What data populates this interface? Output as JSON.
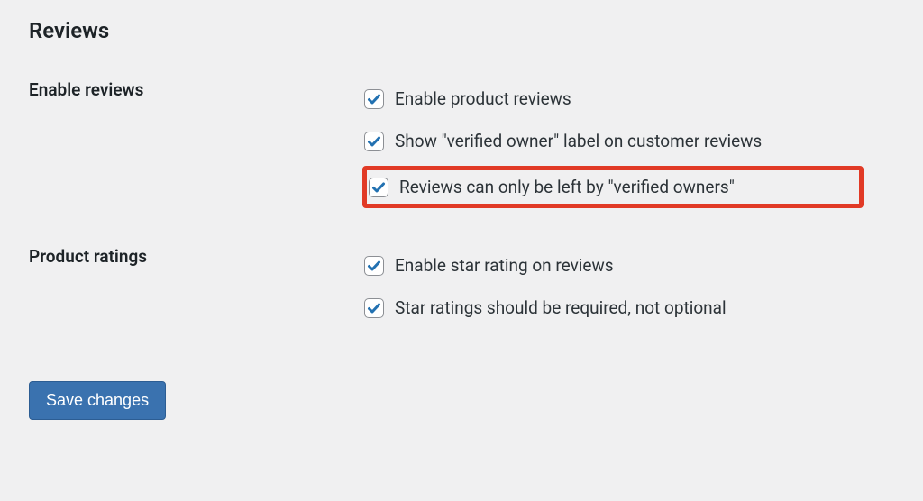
{
  "section": {
    "title": "Reviews"
  },
  "rows": {
    "enable_reviews": {
      "label": "Enable reviews",
      "options": [
        {
          "label": "Enable product reviews",
          "checked": true,
          "highlighted": false
        },
        {
          "label": "Show \"verified owner\" label on customer reviews",
          "checked": true,
          "highlighted": false
        },
        {
          "label": "Reviews can only be left by \"verified owners\"",
          "checked": true,
          "highlighted": true
        }
      ]
    },
    "product_ratings": {
      "label": "Product ratings",
      "options": [
        {
          "label": "Enable star rating on reviews",
          "checked": true,
          "highlighted": false
        },
        {
          "label": "Star ratings should be required, not optional",
          "checked": true,
          "highlighted": false
        }
      ]
    }
  },
  "buttons": {
    "save": "Save changes"
  }
}
